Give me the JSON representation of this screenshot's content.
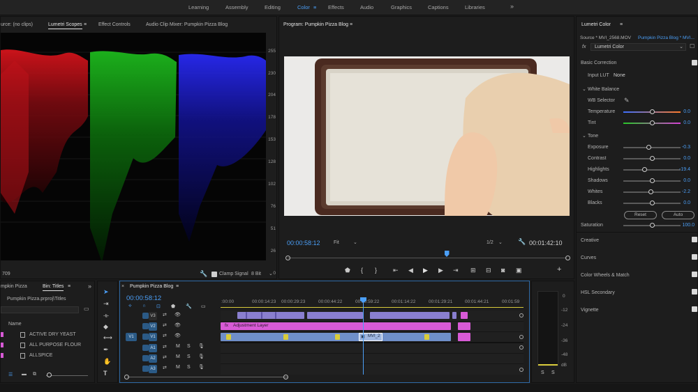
{
  "workspaces": [
    "Learning",
    "Assembly",
    "Editing",
    "Color",
    "Effects",
    "Audio",
    "Graphics",
    "Captions",
    "Libraries"
  ],
  "active_workspace": "Color",
  "more_workspaces": "»",
  "scope_panel": {
    "tabs": [
      "urce: (no clips)",
      "Lumetri Scopes",
      "Effect Controls",
      "Audio Clip Mixer: Pumpkin Pizza Blog"
    ],
    "active_tab": "Lumetri Scopes",
    "scale": [
      "255",
      "230",
      "204",
      "178",
      "153",
      "128",
      "102",
      "76",
      "51",
      "26",
      "0"
    ],
    "left_readout": "709",
    "clamp_signal": "Clamp Signal",
    "bit_depth": "8 Bit"
  },
  "program": {
    "title": "Program: Pumpkin Pizza Blog",
    "timecode": "00:00:58:12",
    "fit": "Fit",
    "resolution": "1/2",
    "duration": "00:01:42:10",
    "playhead_fraction": 0.57
  },
  "project": {
    "tabs": [
      "mpkin Pizza",
      "Bin: Titles"
    ],
    "path": "Pumpkin Pizza.prproj\\Titles",
    "column_name": "Name",
    "items": [
      "ACTIVE DRY YEAST",
      "ALL PURPOSE FLOUR",
      "ALLSPICE"
    ],
    "item_color": "#d85ad6"
  },
  "timeline": {
    "title": "Pumpkin Pizza Blog",
    "timecode": "00:00:58:12",
    "ruler": [
      ":00:00",
      "00:00:14:23",
      "00:00:29:23",
      "00:00:44:22",
      "00:00:59:22",
      "00:01:14:22",
      "00:01:29:21",
      "00:01:44:21",
      "00:01:59"
    ],
    "video_tracks": [
      "V3",
      "V2",
      "V1"
    ],
    "source_patch": "V1",
    "audio_tracks": [
      "A1",
      "A2",
      "A3"
    ],
    "track_icons": {
      "mute": "M",
      "solo": "S"
    },
    "adjustment_label": "Adjustment Layer",
    "clip_label": "MVI_2",
    "colors": {
      "purple": "#8a7fcf",
      "pink": "#d85ad6",
      "blue": "#6f8fc9",
      "playhead": "#4b9ff7"
    }
  },
  "audio_meter": {
    "scale": [
      "0",
      "-12",
      "-24",
      "-36",
      "-48",
      "dB"
    ],
    "solo_buttons": [
      "S",
      "S"
    ]
  },
  "lumetri": {
    "title": "Lumetri Color",
    "source": "Source * MVI_2568.MOV",
    "sequence": "Pumpkin Pizza Blog * MVI...",
    "fx_label": "fx",
    "effect": "Lumetri Color",
    "basic_correction": "Basic Correction",
    "input_lut_label": "Input LUT",
    "input_lut_value": "None",
    "white_balance": "White Balance",
    "wb_selector": "WB Selector",
    "temperature": {
      "label": "Temperature",
      "value": "0.0",
      "level": 0.5
    },
    "tint": {
      "label": "Tint",
      "value": "0.0",
      "level": 0.5
    },
    "tone": "Tone",
    "exposure": {
      "label": "Exposure",
      "value": "-0.3",
      "level": 0.45
    },
    "contrast": {
      "label": "Contrast",
      "value": "0.0",
      "level": 0.5
    },
    "highlights": {
      "label": "Highlights",
      "value": "-19.4",
      "level": 0.37
    },
    "shadows": {
      "label": "Shadows",
      "value": "0.0",
      "level": 0.5
    },
    "whites": {
      "label": "Whites",
      "value": "-2.2",
      "level": 0.48
    },
    "blacks": {
      "label": "Blacks",
      "value": "0.0",
      "level": 0.5
    },
    "reset": "Reset",
    "auto": "Auto",
    "saturation": {
      "label": "Saturation",
      "value": "100.0",
      "level": 0.5
    },
    "sections": [
      "Creative",
      "Curves",
      "Color Wheels & Match",
      "HSL Secondary",
      "Vignette"
    ]
  }
}
